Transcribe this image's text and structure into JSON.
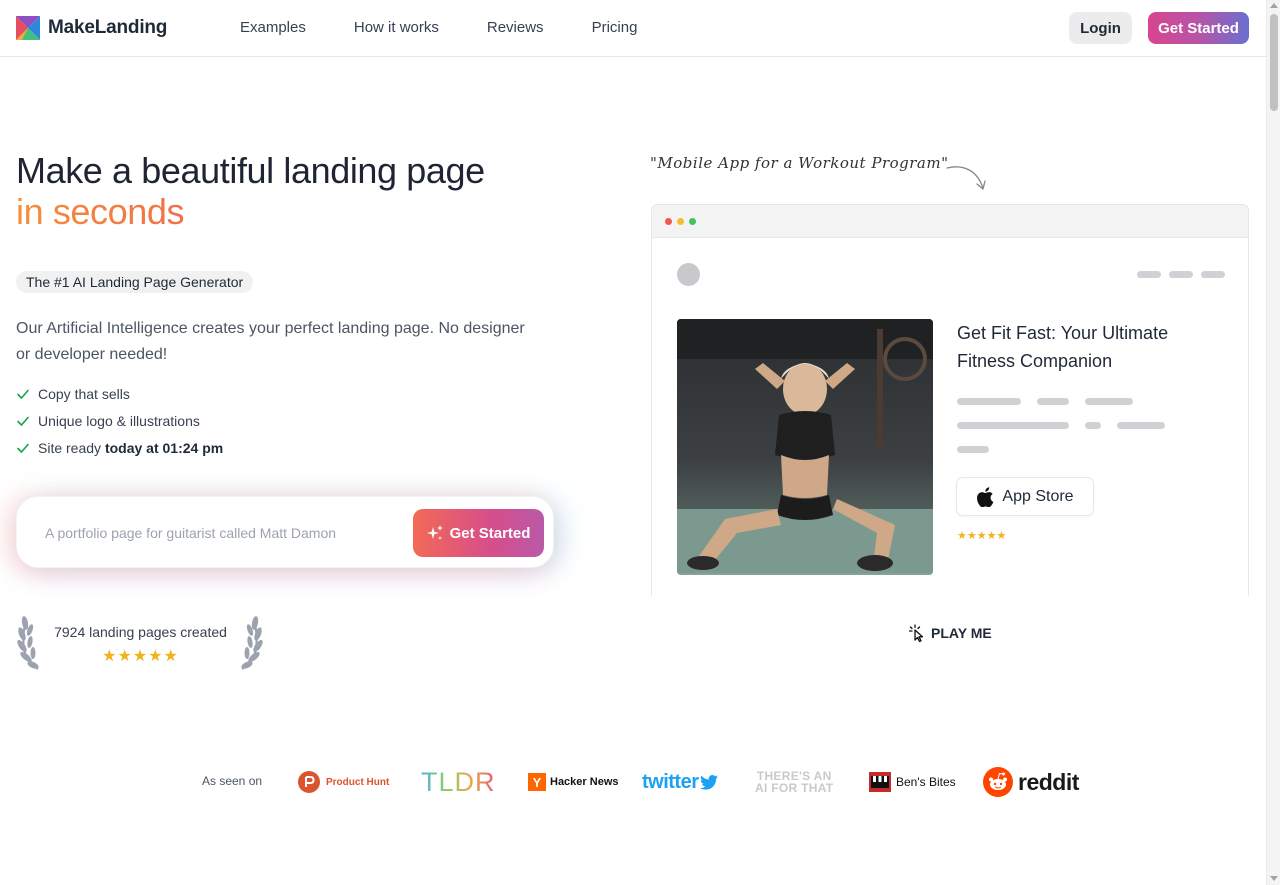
{
  "nav": {
    "brand": "MakeLanding",
    "links": [
      "Examples",
      "How it works",
      "Reviews",
      "Pricing"
    ],
    "login": "Login",
    "get_started": "Get Started"
  },
  "hero": {
    "title_line1": "Make a beautiful landing page",
    "title_line2": "in seconds",
    "badge": "The #1 AI Landing Page Generator",
    "description": "Our Artificial Intelligence creates your perfect landing page. No designer or developer needed!",
    "checks": [
      "Copy that sells",
      "Unique logo & illustrations"
    ],
    "ready_prefix": "Site ready",
    "ready_time": "today at 01:24 pm",
    "prompt_placeholder": "A portfolio page for guitarist called Matt Damon",
    "cta": "Get Started",
    "stats_text": "7924 landing pages created",
    "stats_stars": "★★★★★"
  },
  "preview": {
    "caption": "\"Mobile App for a Workout Program\"",
    "title": "Get Fit Fast: Your Ultimate Fitness Companion",
    "app_store": "App Store",
    "stars": "★★★★★",
    "play_me": "PLAY ME"
  },
  "seen_on": {
    "label": "As seen on",
    "logos": [
      {
        "name": "Product Hunt",
        "text": "Product Hunt"
      },
      {
        "name": "TLDR",
        "text": "TLDR"
      },
      {
        "name": "Hacker News",
        "text": "Hacker News"
      },
      {
        "name": "twitter",
        "text": "twitter"
      },
      {
        "name": "There's an AI for that",
        "text_line1": "THERE'S AN",
        "text_line2": "AI FOR THAT"
      },
      {
        "name": "Ben's Bites",
        "text": "Ben's Bites"
      },
      {
        "name": "reddit",
        "text": "reddit"
      }
    ]
  },
  "colors": {
    "accent_gradient_start": "#f4903a",
    "accent_gradient_end": "#e9446b",
    "cta_gradient_start": "#d9448f",
    "cta_gradient_end": "#6a6fd0",
    "star": "#f2b21c",
    "check": "#16a34a"
  }
}
